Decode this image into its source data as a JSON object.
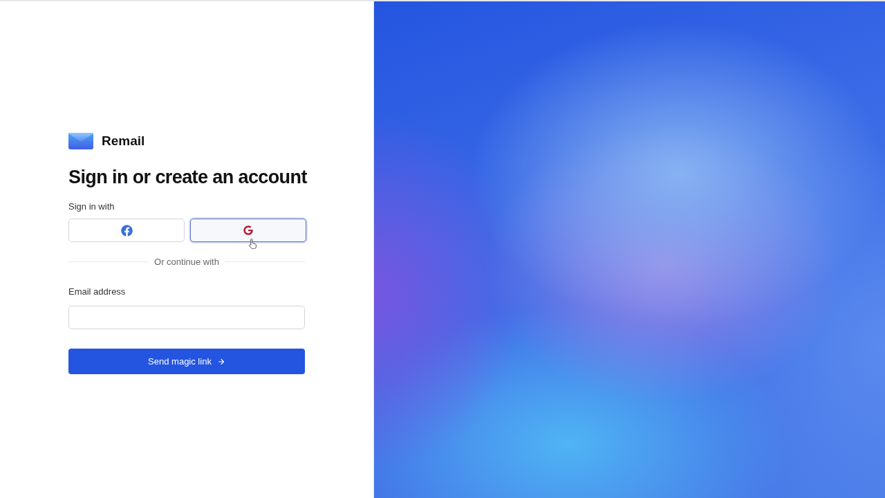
{
  "brand": {
    "name": "Remail"
  },
  "heading": "Sign in or create an account",
  "social": {
    "label": "Sign in with",
    "buttons": [
      {
        "kind": "facebook",
        "focused": false,
        "hovered": false
      },
      {
        "kind": "google",
        "focused": true,
        "hovered": true
      }
    ]
  },
  "divider": "Or continue with",
  "email": {
    "label": "Email address"
  },
  "submit": {
    "label": "Send magic link"
  }
}
